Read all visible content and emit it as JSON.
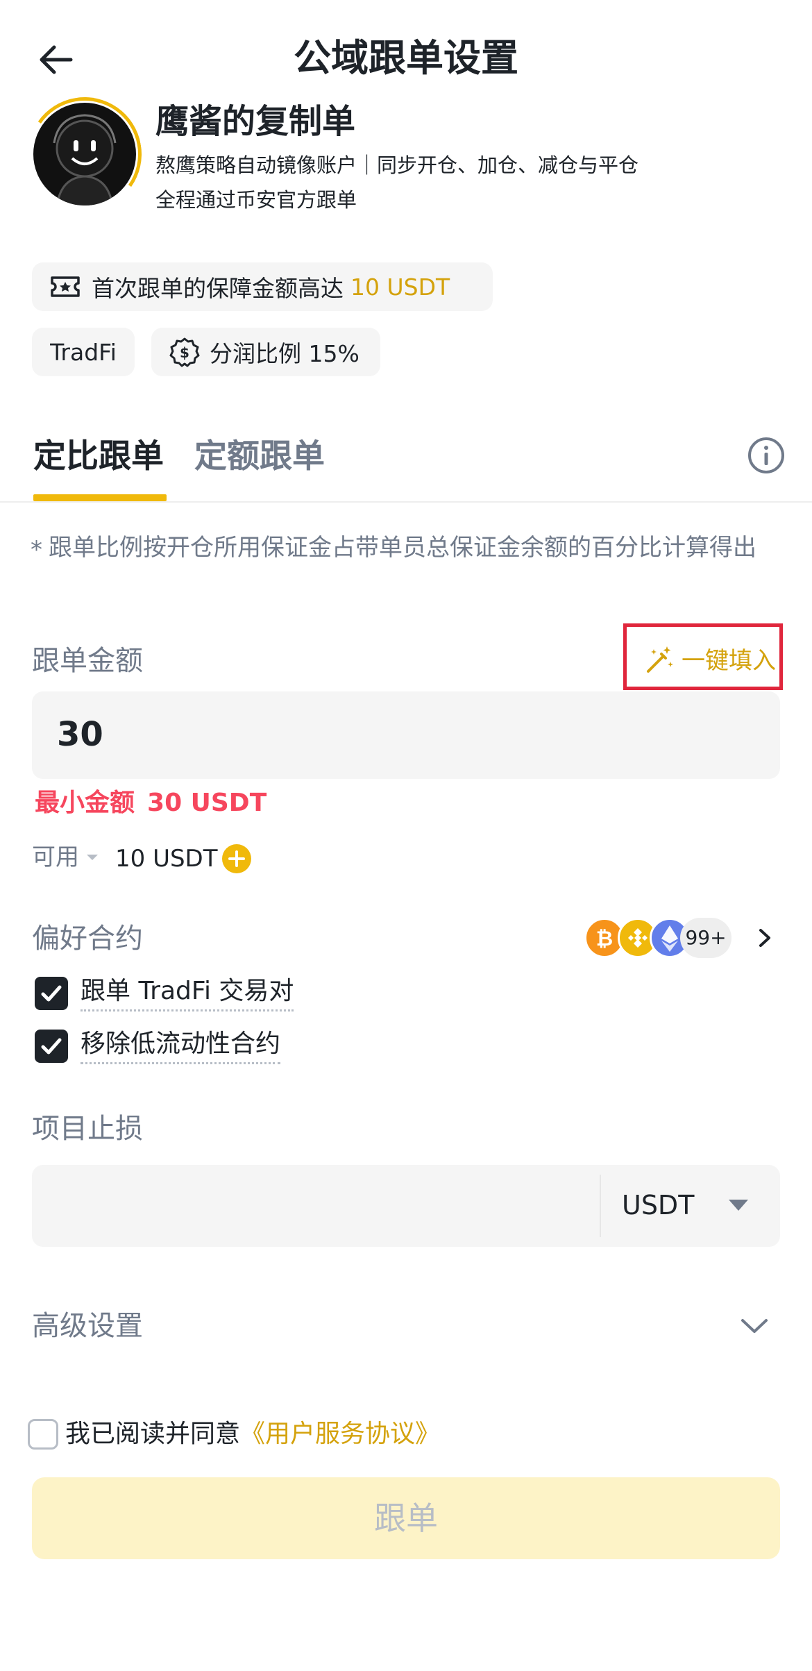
{
  "header": {
    "title": "公域跟单设置"
  },
  "profile": {
    "name": "鹰酱的复制单",
    "description_line1": "熬鹰策略自动镜像账户｜同步开仓、加仓、减仓与平仓",
    "description_line2": "全程通过币安官方跟单"
  },
  "badges": {
    "guarantee_prefix": "首次跟单的保障金额高达",
    "guarantee_amount": "10 USDT",
    "tradfi": "TradFi",
    "profit_share": "分润比例 15%"
  },
  "tabs": [
    {
      "label": "定比跟单",
      "active": true
    },
    {
      "label": "定额跟单",
      "active": false
    }
  ],
  "note": {
    "star": "*",
    "text": "跟单比例按开仓所用保证金占带单员总保证金余额的百分比计算得出"
  },
  "amount": {
    "label": "跟单金额",
    "autofill_label": "一键填入",
    "value": "30",
    "min_label": "最小金额",
    "min_value": "30 USDT",
    "available_label": "可用",
    "available_value": "10 USDT"
  },
  "preferred": {
    "label": "偏好合约",
    "coins": [
      "BTC",
      "BNB",
      "ETH"
    ],
    "more": "99+",
    "options": [
      {
        "label": "跟单 TradFi 交易对",
        "checked": true
      },
      {
        "label": "移除低流动性合约",
        "checked": true
      }
    ]
  },
  "stop_loss": {
    "label": "项目止损",
    "value": "",
    "unit": "USDT"
  },
  "advanced": {
    "label": "高级设置"
  },
  "agreement": {
    "prefix": "我已阅读并同意",
    "link": "《用户服务协议》",
    "checked": false
  },
  "submit": {
    "label": "跟单"
  },
  "colors": {
    "accent": "#f0b90b",
    "link": "#d4a20c",
    "error": "#f6465d",
    "highlight_box": "#e0263c"
  }
}
